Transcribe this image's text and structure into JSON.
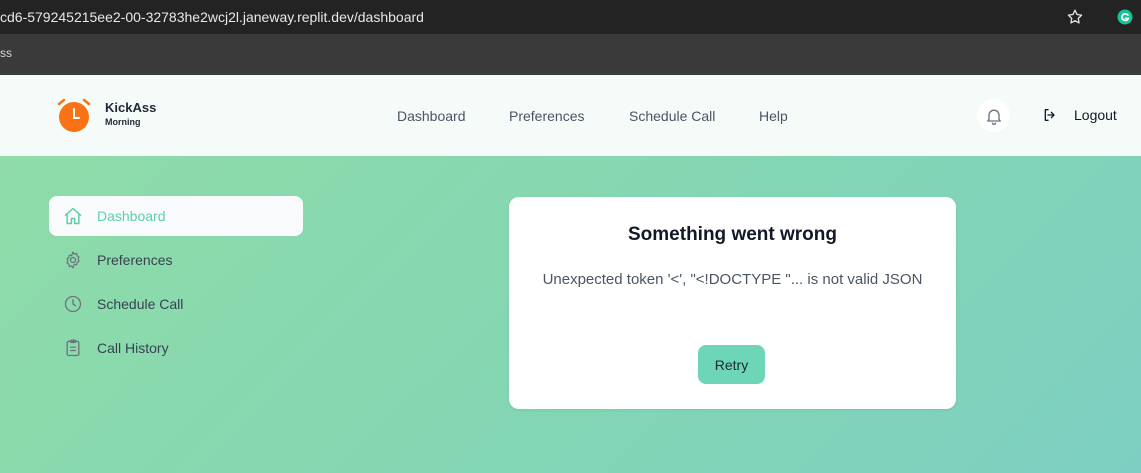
{
  "browser": {
    "url": "cd6-579245215ee2-00-32783he2wcj2l.janeway.replit.dev/dashboard",
    "bookmark_fragment": "ss"
  },
  "header": {
    "logo_title": "KickAss",
    "logo_subtitle": "Morning",
    "nav": [
      "Dashboard",
      "Preferences",
      "Schedule Call",
      "Help"
    ],
    "logout_label": "Logout",
    "accent_color": "#f97316"
  },
  "sidebar": {
    "items": [
      {
        "label": "Dashboard",
        "icon": "home-icon",
        "active": true
      },
      {
        "label": "Preferences",
        "icon": "gear-icon",
        "active": false
      },
      {
        "label": "Schedule Call",
        "icon": "clock-icon",
        "active": false
      },
      {
        "label": "Call History",
        "icon": "clipboard-icon",
        "active": false
      }
    ]
  },
  "error_card": {
    "title": "Something went wrong",
    "message": "Unexpected token '<', \"<!DOCTYPE \"... is not valid JSON",
    "retry_label": "Retry"
  },
  "colors": {
    "active_accent": "#5fcfa8",
    "button": "#6dd6b7"
  }
}
